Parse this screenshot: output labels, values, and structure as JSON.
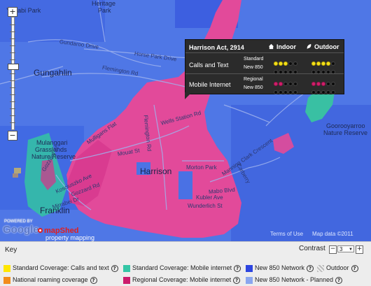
{
  "map": {
    "places": {
      "yerrabi": "Yerrabi Park",
      "heritage": "Heritage",
      "heritage_park": "Park",
      "gungahlin": "Gungahlin",
      "mulanggari": "Mulanggari",
      "grasslands": "Grasslands",
      "nature_reserve": "Nature Reserve",
      "harrison": "Harrison",
      "franklin": "Franklin",
      "goorooyarroo": "Goorooyarroo",
      "goorooyarroo_reserve": "Nature Reserve"
    },
    "roads": {
      "gundaroo": "Gundaroo Drive",
      "horse_park": "Horse Park Drive",
      "flemington": "Flemington Rd",
      "flemington2": "Flemington Rd",
      "mirrabei": "Mirrabei Dr",
      "gozzard": "Gozzard St",
      "mulligans": "Mulligans Flat",
      "wells": "Wells Station Rd",
      "kosciuszko": "Kosciuszko Ave",
      "mouat": "Mouat St",
      "mabo": "Mabo Blvd",
      "manning": "Manning Clark Crescent",
      "carberry": "Carberry",
      "gozzard_road": "Gozzard Rd",
      "morton": "Morton Park",
      "wunderlich": "Wunderlich St",
      "kubler": "Kubler Ave"
    },
    "footer": {
      "powered_by": "POWERED BY",
      "google": "Google",
      "mapshed": "mapShed",
      "mapshed_sub": "property mapping",
      "terms": "Terms of Use",
      "copyright": "Map data ©2011"
    }
  },
  "zoom": {
    "in": "+",
    "out": "−"
  },
  "popup": {
    "title": "Harrison Act, 2914",
    "indoor": "Indoor",
    "outdoor": "Outdoor",
    "rows": [
      {
        "label": "Calls and Text",
        "sub1": "Standard",
        "sub2": "New 850",
        "indoor1": 3,
        "indoor2": 0,
        "outdoor1": 4,
        "outdoor2": 0,
        "color": "#f3df1c"
      },
      {
        "label": "Mobile Internet",
        "sub1": "Regional",
        "sub2": "New 850",
        "indoor1": 2,
        "indoor2": 0,
        "outdoor1": 3,
        "outdoor2": 0,
        "color": "#d1206b"
      }
    ]
  },
  "key": {
    "title": "Key",
    "contrast_label": "Contrast",
    "contrast_value": "3",
    "minus": "−",
    "plus": "+",
    "items": [
      {
        "label": "Standard Coverage: Calls and text",
        "color": "#ffe600"
      },
      {
        "label": "Standard Coverage: Mobile internet",
        "color": "#34c6a6"
      },
      {
        "label": "New 850 Network",
        "color": "#2d45e0"
      },
      {
        "label": "Outdoor",
        "color": "#cfcfcf"
      },
      {
        "label": "National roaming coverage",
        "color": "#f28c1c"
      },
      {
        "label": "Regional Coverage: Mobile internet",
        "color": "#cc1b6c"
      },
      {
        "label": "New 850 Network - Planned",
        "color": "#8aa6ef"
      }
    ],
    "help": "?"
  }
}
